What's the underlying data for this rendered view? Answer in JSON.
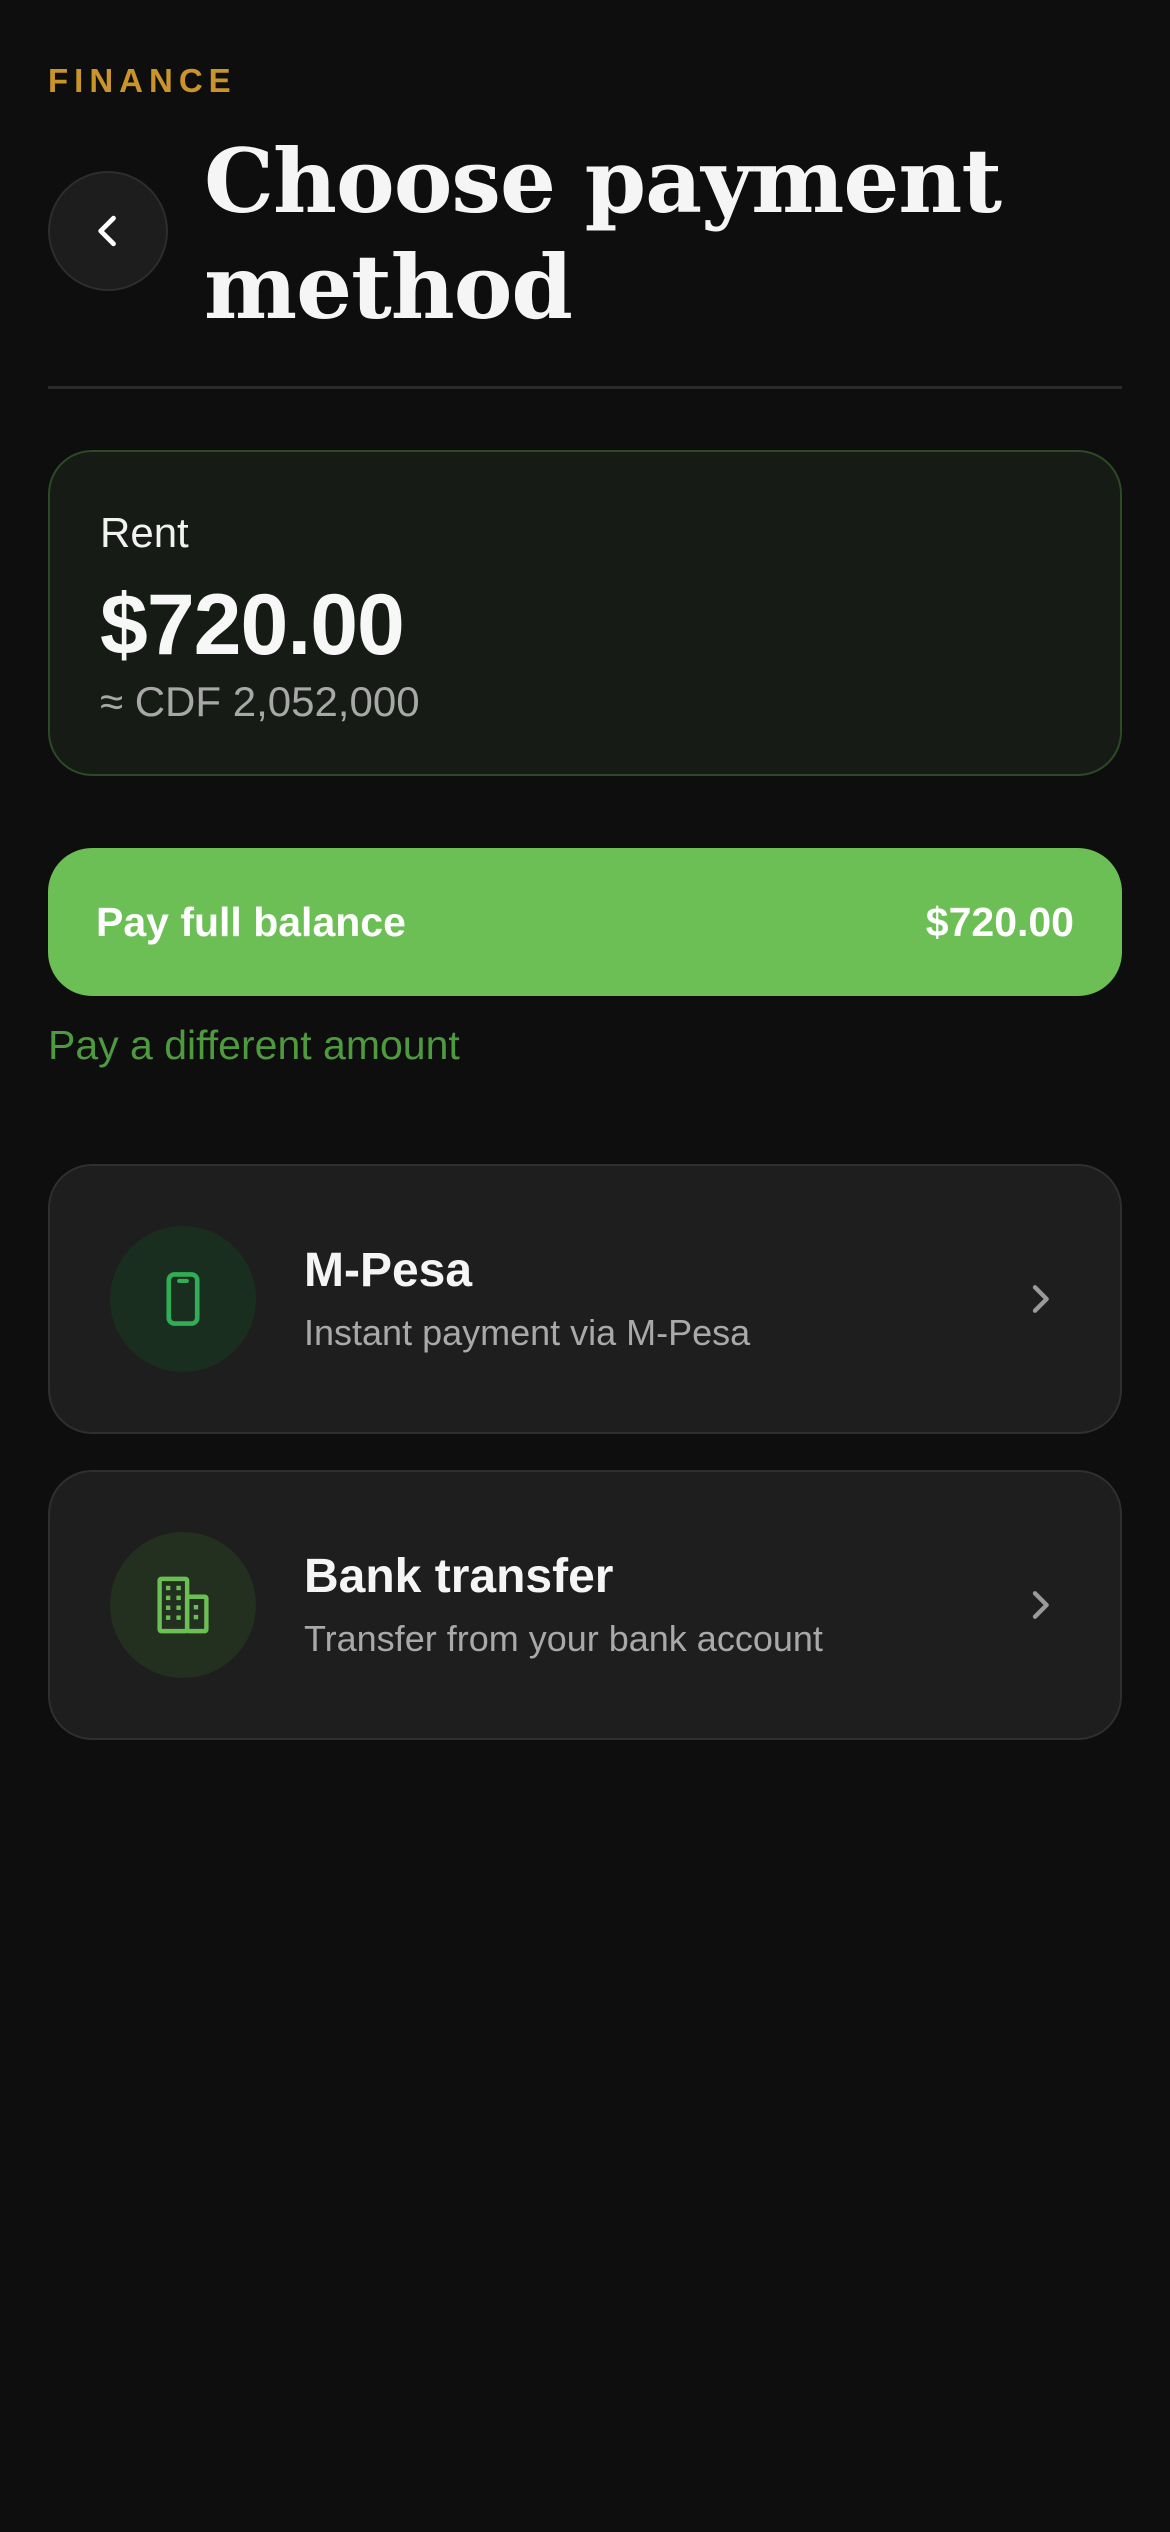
{
  "header": {
    "eyebrow": "FINANCE",
    "title": "Choose payment method"
  },
  "summary": {
    "label": "Rent",
    "amount": "$720.00",
    "converted": "≈ CDF 2,052,000"
  },
  "pay_full": {
    "label": "Pay full balance",
    "amount": "$720.00"
  },
  "different_amount_label": "Pay a different amount",
  "methods": [
    {
      "title": "M-Pesa",
      "subtitle": "Instant payment via M-Pesa",
      "icon": "phone-icon"
    },
    {
      "title": "Bank transfer",
      "subtitle": "Transfer from your bank account",
      "icon": "bank-building-icon"
    }
  ],
  "colors": {
    "background": "#0e0e0e",
    "accent_gold": "#c9952b",
    "primary_green": "#6bbf55",
    "link_green": "#4e9a3e",
    "mpesa_green": "#2fae55"
  }
}
